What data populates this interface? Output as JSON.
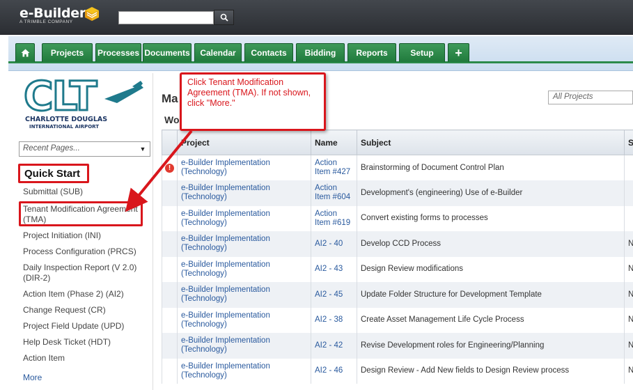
{
  "header": {
    "brand": "e-Builder",
    "brand_sub": "A TRIMBLE COMPANY",
    "search_placeholder": ""
  },
  "tabs": [
    {
      "label": "",
      "icon": "home-icon"
    },
    {
      "label": "Projects"
    },
    {
      "label": "Processes"
    },
    {
      "label": "Documents"
    },
    {
      "label": "Calendar"
    },
    {
      "label": "Contacts"
    },
    {
      "label": "Bidding"
    },
    {
      "label": "Reports"
    },
    {
      "label": "Setup"
    },
    {
      "label": "+"
    }
  ],
  "sidebar": {
    "logo_text": "CLT",
    "logo_line1": "CHARLOTTE DOUGLAS",
    "logo_line2": "INTERNATIONAL AIRPORT",
    "recent_pages": "Recent Pages...",
    "quick_start_title": "Quick Start",
    "items": [
      "Submittal (SUB)",
      "Tenant Modification Agreement (TMA)",
      "Project Initiation (INI)",
      "Process Configuration (PRCS)",
      "Daily Inspection Report (V 2.0) (DIR-2)",
      "Action Item (Phase 2) (AI2)",
      "Change Request (CR)",
      "Project Field Update (UPD)",
      "Help Desk Ticket (HDT)",
      "Action Item",
      "More"
    ]
  },
  "main": {
    "title": "Ma",
    "subtitle": "Wo",
    "project_filter": "All Projects",
    "columns": [
      "Project",
      "Name",
      "Subject",
      "S"
    ],
    "rows": [
      {
        "project": "e-Builder Implementation (Technology)",
        "name": "Action Item #427",
        "subject": "Brainstorming of Document Control Plan",
        "s": "",
        "alert": "!"
      },
      {
        "project": "e-Builder Implementation (Technology)",
        "name": "Action Item #604",
        "subject": "Development's (engineering) Use of e-Builder",
        "s": "",
        "alert": ""
      },
      {
        "project": "e-Builder Implementation (Technology)",
        "name": "Action Item #619",
        "subject": "Convert existing forms to processes",
        "s": "",
        "alert": ""
      },
      {
        "project": "e-Builder Implementation (Technology)",
        "name": "AI2 - 40",
        "subject": "Develop CCD Process",
        "s": "N",
        "alert": ""
      },
      {
        "project": "e-Builder Implementation (Technology)",
        "name": "AI2 - 43",
        "subject": "Design Review modifications",
        "s": "N",
        "alert": ""
      },
      {
        "project": "e-Builder Implementation (Technology)",
        "name": "AI2 - 45",
        "subject": "Update Folder Structure for Development Template",
        "s": "N",
        "alert": ""
      },
      {
        "project": "e-Builder Implementation (Technology)",
        "name": "AI2 - 38",
        "subject": "Create Asset Management Life Cycle Process",
        "s": "N",
        "alert": ""
      },
      {
        "project": "e-Builder Implementation (Technology)",
        "name": "AI2 - 42",
        "subject": "Revise Development roles for Engineering/Planning",
        "s": "N",
        "alert": ""
      },
      {
        "project": "e-Builder Implementation (Technology)",
        "name": "AI2 - 46",
        "subject": "Design Review - Add New fields to Design Review process",
        "s": "N",
        "alert": ""
      }
    ]
  },
  "callout": {
    "text": "Click Tenant Modification Agreement (TMA). If not shown, click \"More.\""
  },
  "colors": {
    "tab_green": "#207a3c",
    "callout_red": "#d9161c",
    "link_blue": "#2a5a9e",
    "clt_teal": "#1f7a8c",
    "clt_navy": "#1b3563"
  }
}
